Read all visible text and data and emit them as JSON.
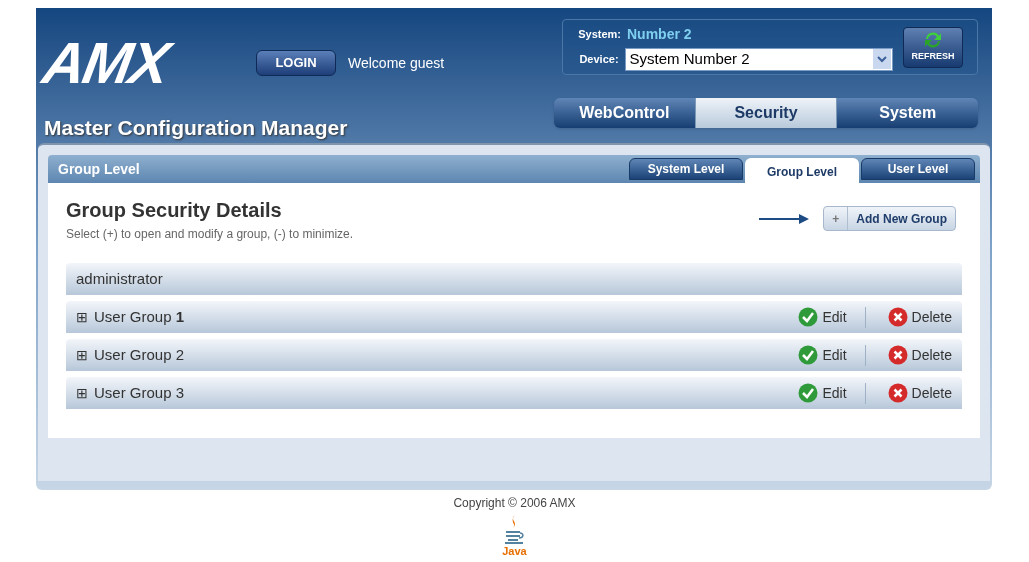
{
  "header": {
    "logo": "AMX",
    "login_button": "LOGIN",
    "welcome": "Welcome guest",
    "app_title": "Master Configuration Manager"
  },
  "system_box": {
    "system_label": "System:",
    "system_value": "Number 2",
    "device_label": "Device:",
    "device_value": "System Number 2",
    "refresh_button": "REFRESH"
  },
  "main_tabs": [
    {
      "label": "WebControl",
      "selected": false
    },
    {
      "label": "Security",
      "selected": true
    },
    {
      "label": "System",
      "selected": false
    }
  ],
  "panel": {
    "title": "Group Level",
    "sub_tabs": [
      {
        "label": "System Level",
        "selected": false
      },
      {
        "label": "Group Level",
        "selected": true
      },
      {
        "label": "User Level",
        "selected": false
      }
    ],
    "heading": "Group Security Details",
    "hint": "Select (+) to open and modify a group, (-) to minimize.",
    "add_button": {
      "icon": "+",
      "label": "Add New Group"
    },
    "groups": [
      {
        "name": "administrator",
        "kind": "fixed"
      },
      {
        "name": "User Group **1**",
        "kind": "editable",
        "expand": "⊞",
        "edit": "Edit",
        "delete": "Delete"
      },
      {
        "name": "User Group 2",
        "kind": "editable",
        "expand": "⊞",
        "edit": "Edit",
        "delete": "Delete"
      },
      {
        "name": "User Group 3",
        "kind": "editable",
        "expand": "⊞",
        "edit": "Edit",
        "delete": "Delete"
      }
    ]
  },
  "footer": {
    "copyright": "Copyright © 2006 AMX",
    "java": "Java"
  }
}
